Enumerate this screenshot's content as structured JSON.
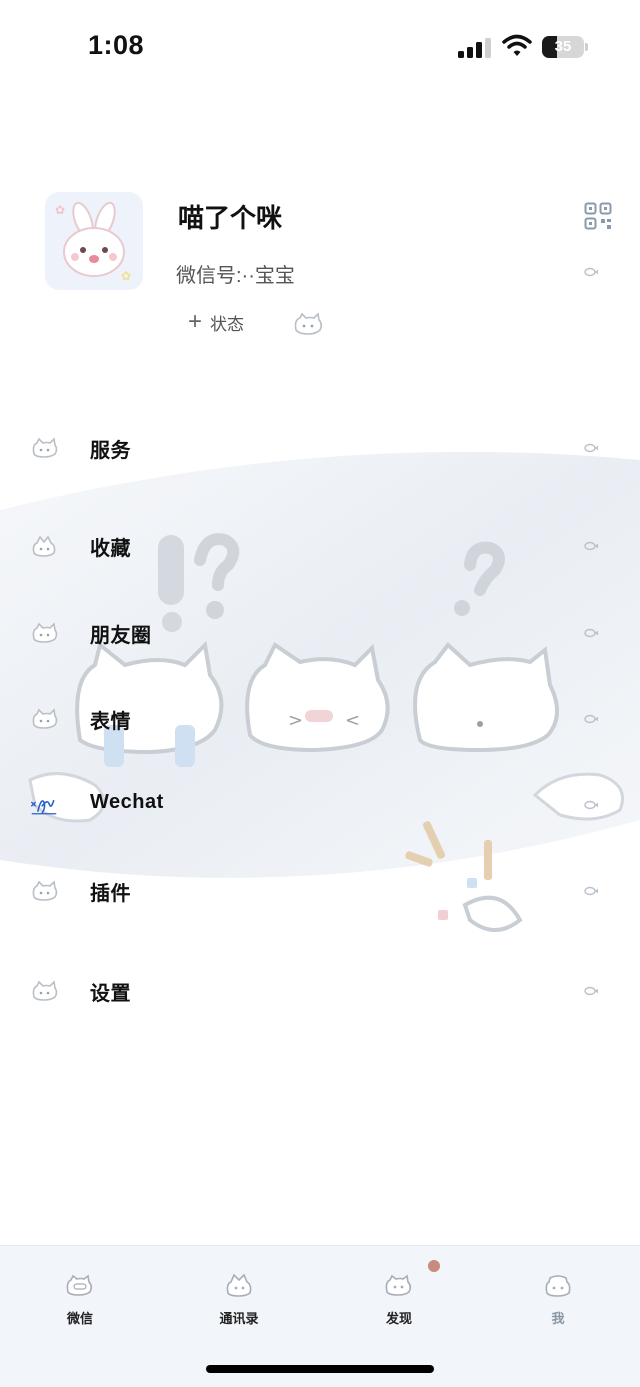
{
  "status_bar": {
    "time": "1:08",
    "battery_level": "35",
    "signal_icon": "cellular-signal-icon",
    "wifi_icon": "wifi-icon"
  },
  "profile": {
    "name": "喵了个咪",
    "wechat_id": "微信号:··宝宝",
    "status_label": "状态",
    "add_status_icon": "plus-icon",
    "qr_icon": "qr-code-icon",
    "avatar_icon": "bunny-avatar"
  },
  "menu": [
    {
      "label": "服务",
      "icon": "cat-face-icon"
    },
    {
      "label": "收藏",
      "icon": "cat-hat-icon"
    },
    {
      "label": "朋友圈",
      "icon": "cat-face-icon"
    },
    {
      "label": "表情",
      "icon": "cat-face-icon"
    },
    {
      "label": "Wechat",
      "icon": "signature-icon"
    },
    {
      "label": "插件",
      "icon": "cat-face-icon"
    },
    {
      "label": "设置",
      "icon": "cat-face-icon"
    }
  ],
  "tab_bar": {
    "tabs": [
      {
        "label": "微信",
        "icon": "chat-cat-icon",
        "selected": false
      },
      {
        "label": "通讯录",
        "icon": "contacts-cat-icon",
        "selected": false
      },
      {
        "label": "发现",
        "icon": "discover-cat-icon",
        "selected": false,
        "badge": true
      },
      {
        "label": "我",
        "icon": "me-cat-icon",
        "selected": true
      }
    ]
  },
  "colors": {
    "accent_chevron": "#b8c2cc",
    "tab_bar_bg": "#f2f6fa",
    "badge": "#c98a80",
    "signature_blue": "#2a5fc7"
  }
}
